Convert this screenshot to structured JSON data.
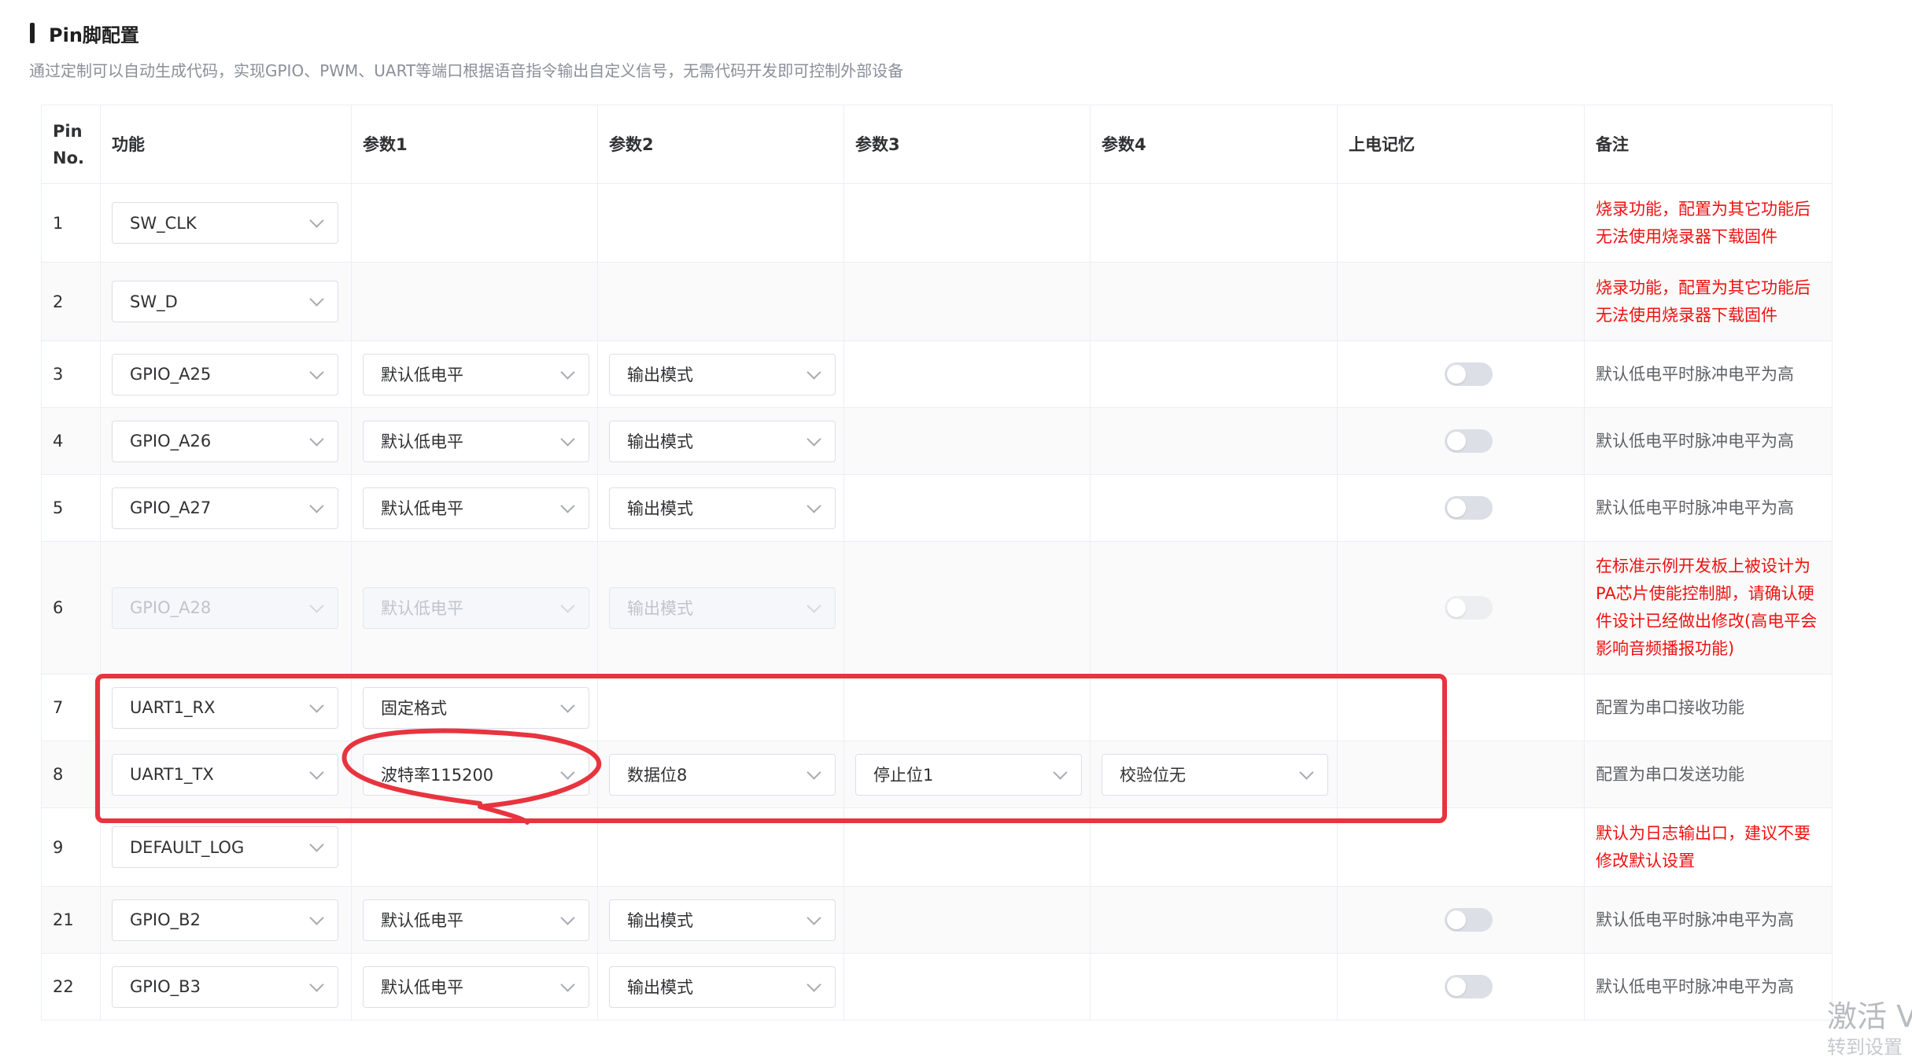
{
  "section": {
    "title": "Pin脚配置",
    "description": "通过定制可以自动生成代码，实现GPIO、PWM、UART等端口根据语音指令输出自定义信号，无需代码开发即可控制外部设备"
  },
  "table": {
    "headers": {
      "pin": "Pin No.",
      "func": "功能",
      "p1": "参数1",
      "p2": "参数2",
      "p3": "参数3",
      "p4": "参数4",
      "mem": "上电记忆",
      "remark": "备注"
    },
    "rows": [
      {
        "pin": "1",
        "func": "SW_CLK",
        "remark": "烧录功能，配置为其它功能后无法使用烧录器下载固件",
        "remark_warn": true
      },
      {
        "pin": "2",
        "func": "SW_D",
        "remark": "烧录功能，配置为其它功能后无法使用烧录器下载固件",
        "remark_warn": true
      },
      {
        "pin": "3",
        "func": "GPIO_A25",
        "p1": "默认低电平",
        "p2": "输出模式",
        "toggle": true,
        "toggle_on": false,
        "remark": "默认低电平时脉冲电平为高"
      },
      {
        "pin": "4",
        "func": "GPIO_A26",
        "p1": "默认低电平",
        "p2": "输出模式",
        "toggle": true,
        "toggle_on": false,
        "remark": "默认低电平时脉冲电平为高"
      },
      {
        "pin": "5",
        "func": "GPIO_A27",
        "p1": "默认低电平",
        "p2": "输出模式",
        "toggle": true,
        "toggle_on": false,
        "remark": "默认低电平时脉冲电平为高"
      },
      {
        "pin": "6",
        "func": "GPIO_A28",
        "p1": "默认低电平",
        "p2": "输出模式",
        "toggle": true,
        "toggle_on": false,
        "disabled": true,
        "remark": "在标准示例开发板上被设计为PA芯片使能控制脚，请确认硬件设计已经做出修改(高电平会影响音频播报功能)",
        "remark_warn": true
      },
      {
        "pin": "7",
        "func": "UART1_RX",
        "p1": "固定格式",
        "remark": "配置为串口接收功能"
      },
      {
        "pin": "8",
        "func": "UART1_TX",
        "p1": "波特率115200",
        "p2": "数据位8",
        "p3": "停止位1",
        "p4": "校验位无",
        "remark": "配置为串口发送功能"
      },
      {
        "pin": "9",
        "func": "DEFAULT_LOG",
        "remark": "默认为日志输出口，建议不要修改默认设置",
        "remark_warn": true
      },
      {
        "pin": "21",
        "func": "GPIO_B2",
        "p1": "默认低电平",
        "p2": "输出模式",
        "toggle": true,
        "toggle_on": false,
        "remark": "默认低电平时脉冲电平为高"
      },
      {
        "pin": "22",
        "func": "GPIO_B3",
        "p1": "默认低电平",
        "p2": "输出模式",
        "toggle": true,
        "toggle_on": false,
        "remark": "默认低电平时脉冲电平为高"
      }
    ]
  },
  "watermark": {
    "line1": "激活 V",
    "line2": "转到设置"
  },
  "colors": {
    "warn_text": "#f01010",
    "annotation": "#e8343f",
    "row_alt": "#fafafa",
    "border": "#ebeef5"
  }
}
